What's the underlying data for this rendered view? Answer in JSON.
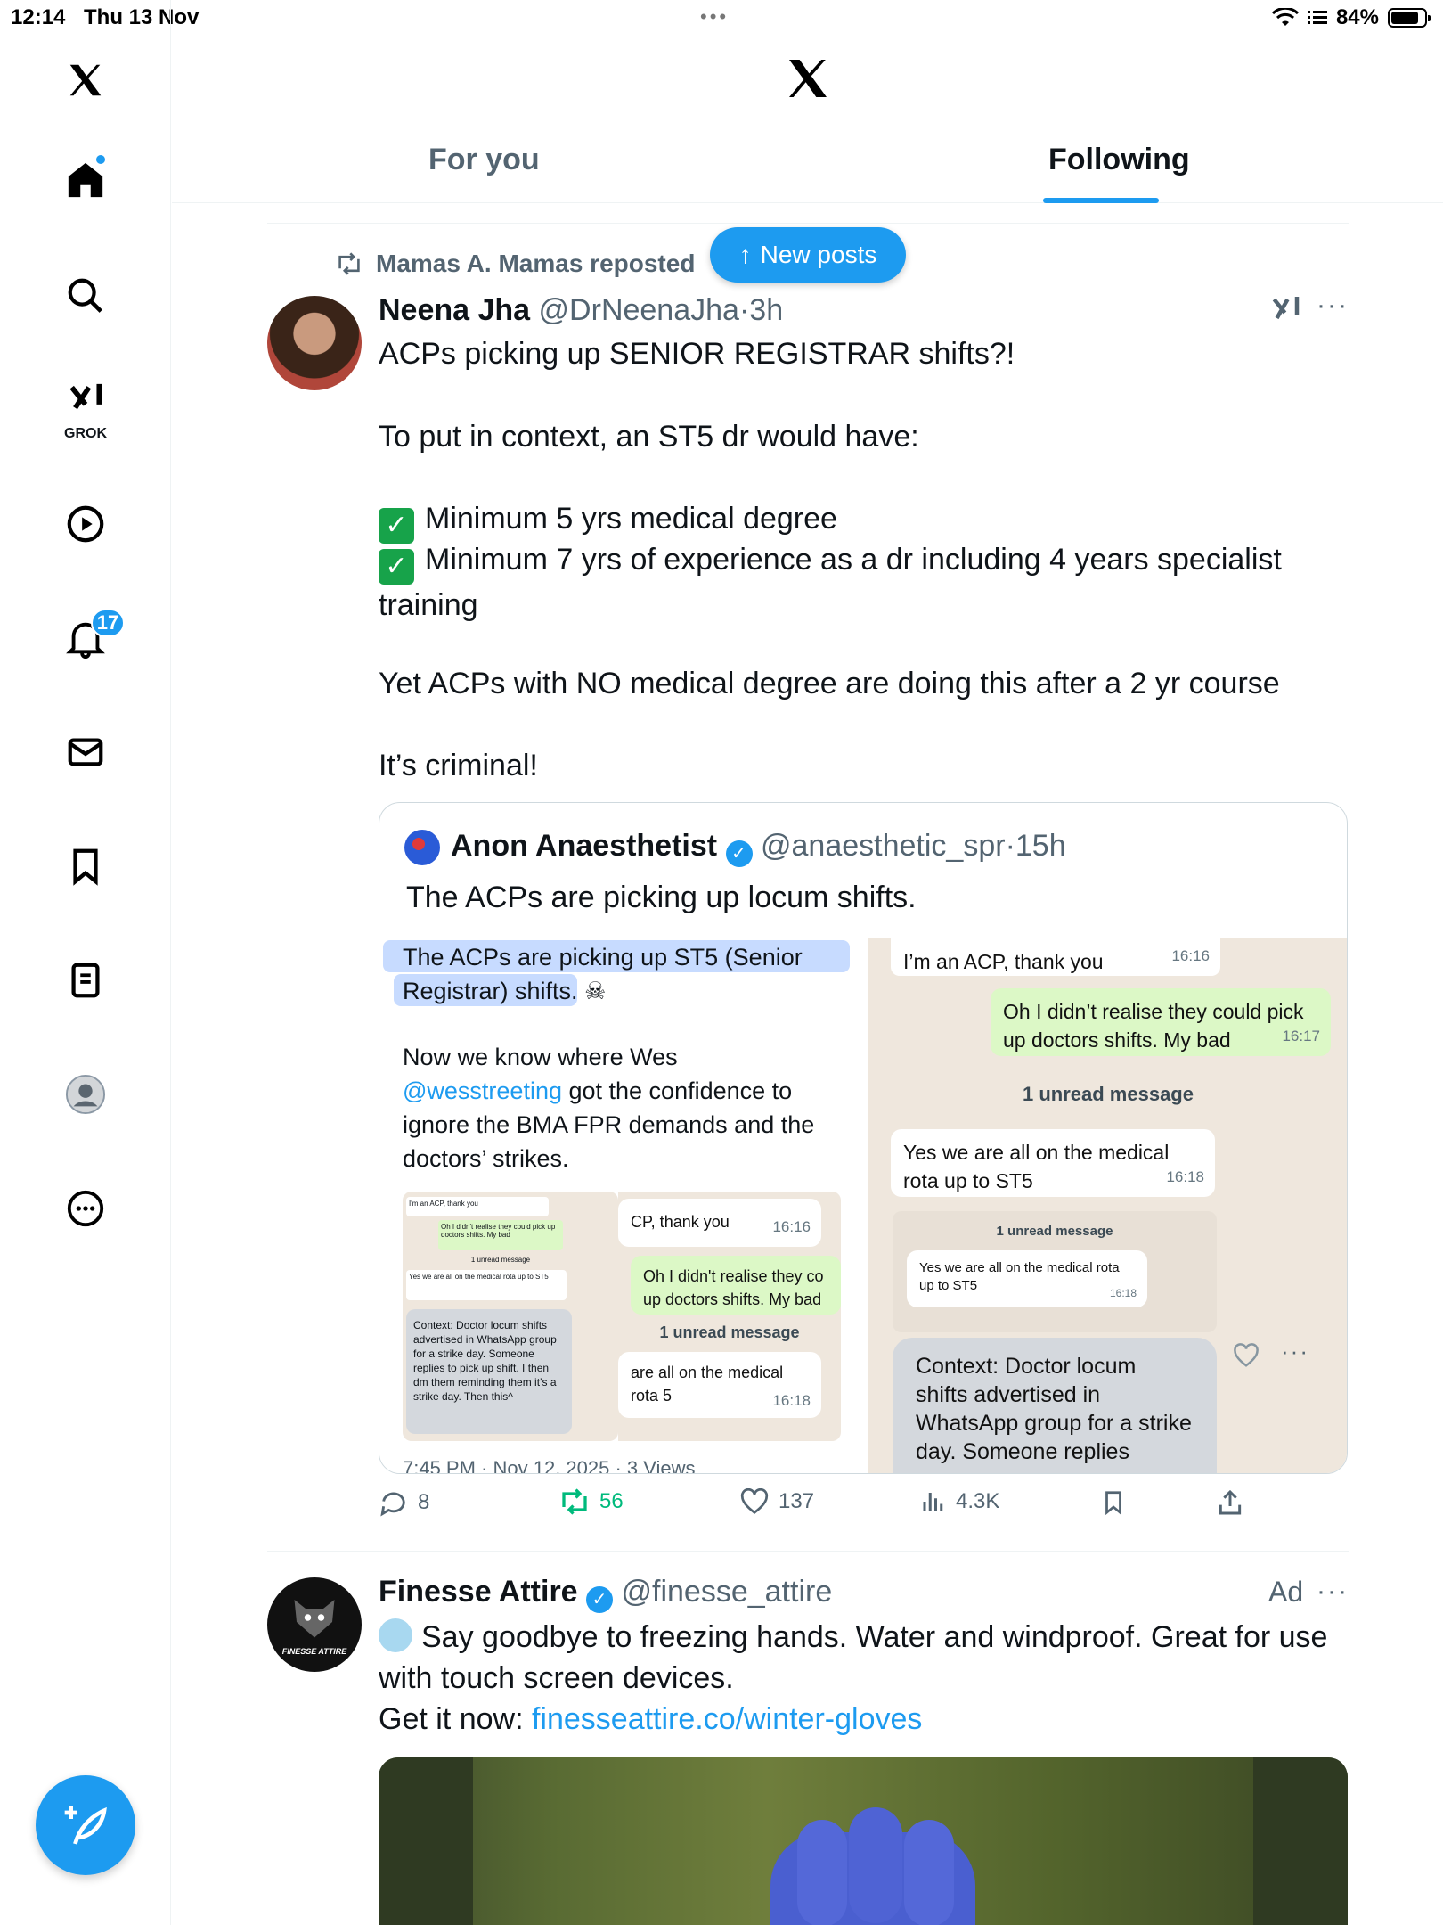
{
  "status_bar": {
    "time": "12:14",
    "date": "Thu 13 Nov",
    "battery": "84%",
    "battery_level": 0.84
  },
  "sidebar": {
    "grok_label": "GROK",
    "notifications_count": "17"
  },
  "header": {
    "tabs": [
      {
        "label": "For you",
        "active": false
      },
      {
        "label": "Following",
        "active": true
      }
    ]
  },
  "new_posts_label": "New posts",
  "post1": {
    "reposted_by": "Mamas A. Mamas reposted",
    "author_name": "Neena Jha",
    "author_handle": "@DrNeenaJha",
    "time": "3h",
    "text_line1": "ACPs picking up SENIOR REGISTRAR shifts?!",
    "text_line2": "To put in context, an ST5 dr would have:",
    "check1": "Minimum 5 yrs medical degree",
    "check2": "Minimum 7 yrs of experience as a dr including 4 years specialist training",
    "text_line3": "Yet ACPs with NO medical degree are doing this after a 2 yr course",
    "text_line4": "It’s criminal!",
    "quote": {
      "author_name": "Anon Anaesthetist",
      "author_handle": "@anaesthetic_spr",
      "time": "15h",
      "text": "The ACPs are picking up locum shifts.",
      "left_image": {
        "highlight_text_a": "The ACPs are picking up ST5 (Senior",
        "highlight_text_b": "Registrar) shifts.",
        "para_a": "Now we know where Wes",
        "mention": "@wesstreeting",
        "para_b": " got the confidence to",
        "para_c": "ignore the BMA FPR demands and the",
        "para_d": "doctors’ strikes.",
        "mini_context": "Context: Doctor locum shifts advertised in WhatsApp group for a strike day. Someone replies to pick up shift. I then dm them reminding them it’s a strike day. Then this^",
        "mini_msg1": "I'm an ACP, thank you",
        "mini_msg2": "Oh I didn't realise they could pick up doctors shifts. My bad",
        "mini_unread": "1 unread message",
        "mini_msg3": "Yes we are all on the medical rota up to ST5",
        "crop_msg1": "CP, thank you",
        "crop_ts1": "16:16",
        "crop_msg2": "Oh I didn't realise they co up doctors shifts. My bad",
        "crop_unread": "1 unread message",
        "crop_msg3": "are all on the medical rota 5",
        "crop_ts3": "16:18",
        "footer_meta": "7:45 PM · Nov 12, 2025 · 3 Views"
      },
      "right_image": {
        "msg1": "I’m an ACP, thank you",
        "ts1": "16:16",
        "msg2": "Oh I didn’t realise they could pick up doctors shifts. My bad",
        "ts2": "16:17",
        "unread": "1 unread message",
        "msg3": "Yes we are all on the medical rota up to ST5",
        "ts3": "16:18",
        "small_unread": "1 unread message",
        "small_msg": "Yes we are all on the medical rota up to ST5",
        "small_ts": "16:18",
        "context": "Context: Doctor locum shifts advertised in WhatsApp group for a strike day. Someone replies"
      }
    },
    "stats": {
      "replies": "8",
      "reposts": "56",
      "likes": "137",
      "views": "4.3K"
    }
  },
  "post2": {
    "author_name": "Finesse Attire",
    "author_handle": "@finesse_attire",
    "ad_label": "Ad",
    "text_a": "Say goodbye to freezing hands. Water and windproof. Great for use with touch screen devices.",
    "text_b": "Get it now: ",
    "link": "finesseattire.co/winter-gloves",
    "avatar_text": "FINESSE ATTIRE"
  },
  "colors": {
    "accent": "#1d9bf0",
    "repost_green": "#00ba7c",
    "text": "#0f1419",
    "muted": "#536471"
  }
}
